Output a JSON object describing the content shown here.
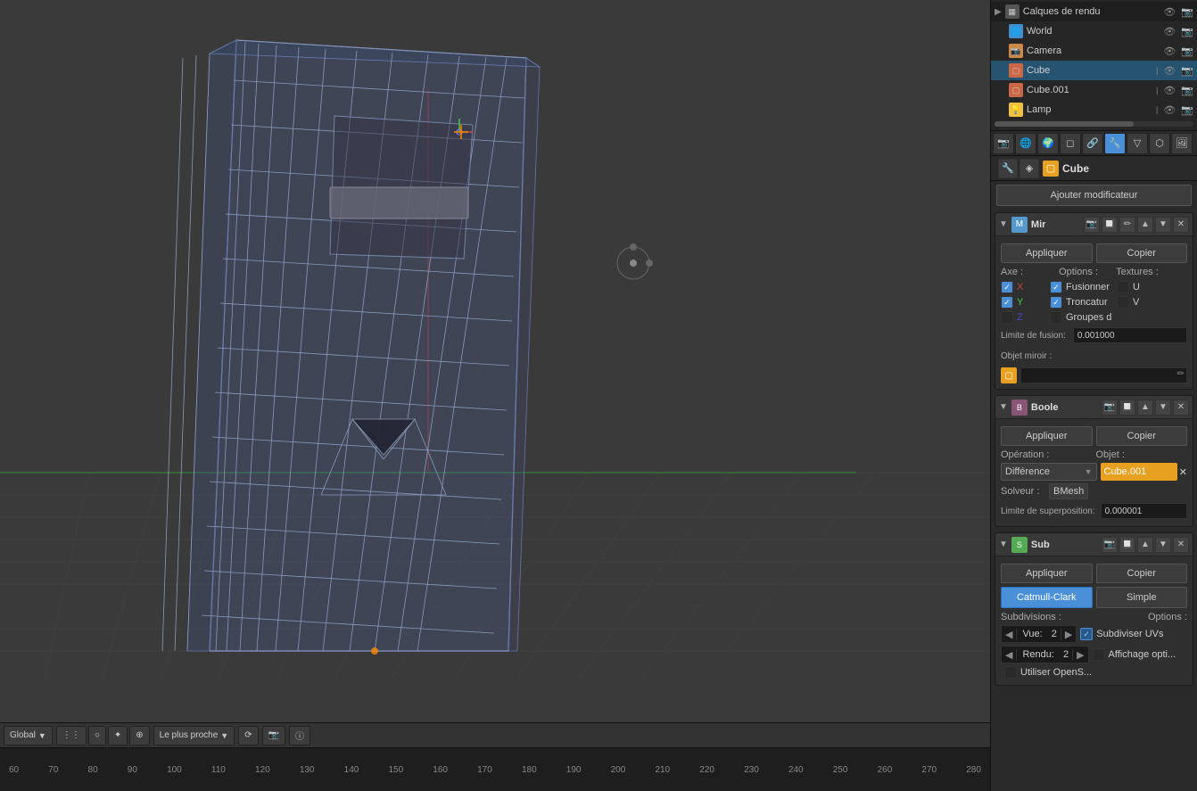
{
  "outliner": {
    "items": [
      {
        "id": "calques-de-rendu",
        "name": "Calques de rendu",
        "icon": "▦",
        "icon_color": "#666",
        "indent": 0,
        "separator": true
      },
      {
        "id": "world",
        "name": "World",
        "icon": "🌐",
        "icon_color": "#4090d0",
        "indent": 1
      },
      {
        "id": "camera",
        "name": "Camera",
        "icon": "📷",
        "icon_color": "#cc8844",
        "indent": 1
      },
      {
        "id": "cube",
        "name": "Cube",
        "icon": "▢",
        "icon_color": "#e05050",
        "indent": 1,
        "active": true
      },
      {
        "id": "cube001",
        "name": "Cube.001",
        "icon": "▢",
        "icon_color": "#e05050",
        "indent": 1
      },
      {
        "id": "lamp",
        "name": "Lamp",
        "icon": "💡",
        "icon_color": "#f0c040",
        "indent": 1
      }
    ]
  },
  "properties_panel": {
    "icon_tabs": [
      "🔧",
      "📷",
      "🌐",
      "🔩",
      "🎨",
      "🖼️",
      "⚙️",
      "🔲",
      "🔷"
    ],
    "object_name": "Cube",
    "add_modifier_label": "Ajouter modificateur",
    "modifiers": [
      {
        "id": "mirror",
        "name": "Mir",
        "icon": "M",
        "icon_color": "#5599cc",
        "apply_label": "Appliquer",
        "copy_label": "Copier",
        "sections": [
          {
            "type": "axis_options_textures",
            "axe_label": "Axe :",
            "options_label": "Options :",
            "textures_label": "Textures :",
            "axes": [
              {
                "label": "X",
                "checked": true
              },
              {
                "label": "Y",
                "checked": true
              },
              {
                "label": "Z",
                "checked": false
              }
            ],
            "options": [
              {
                "label": "Fusionner",
                "checked": true
              },
              {
                "label": "Troncatur",
                "checked": true
              },
              {
                "label": "Groupes d",
                "checked": false
              }
            ],
            "textures": [
              {
                "label": "U",
                "checked": false
              },
              {
                "label": "V",
                "checked": false
              }
            ]
          }
        ],
        "limite_de_fusion_label": "Limite de fusion:",
        "limite_de_fusion_value": "0.001000",
        "objet_miroir_label": "Objet miroir :",
        "objet_miroir_value": ""
      },
      {
        "id": "boolean",
        "name": "Boole",
        "icon": "B",
        "icon_color": "#8855cc",
        "apply_label": "Appliquer",
        "copy_label": "Copier",
        "operation_label": "Opération :",
        "operation_value": "Différence",
        "objet_label": "Objet :",
        "objet_value": "Cube.001",
        "solveur_label": "Solveur :",
        "solveur_value": "BMesh",
        "limite_superposition_label": "Limite de superposition:",
        "limite_superposition_value": "0.000001"
      },
      {
        "id": "subdivision",
        "name": "Sub",
        "icon": "S",
        "icon_color": "#55aa55",
        "apply_label": "Appliquer",
        "copy_label": "Copier",
        "catmull_clark_label": "Catmull-Clark",
        "simple_label": "Simple",
        "subdivisions_label": "Subdivisions :",
        "options_label": "Options :",
        "vue_label": "Vue:",
        "vue_value": "2",
        "rendu_label": "Rendu:",
        "rendu_value": "2",
        "subdiviser_uvs_label": "Subdiviser UVs",
        "affichage_opti_label": "Affichage opti...",
        "utiliser_opens_label": "Utiliser OpenS..."
      }
    ]
  },
  "viewport": {
    "mode": "Global",
    "snap_label": "Le plus proche",
    "axes": {
      "x_color": "#cc3333",
      "y_color": "#33aa33",
      "z_color": "#3333cc"
    }
  },
  "timeline": {
    "numbers": [
      "60",
      "70",
      "80",
      "90",
      "100",
      "110",
      "120",
      "130",
      "140",
      "150",
      "160",
      "170",
      "180",
      "190",
      "200",
      "210",
      "220",
      "230",
      "240",
      "250",
      "260",
      "270",
      "280"
    ]
  }
}
